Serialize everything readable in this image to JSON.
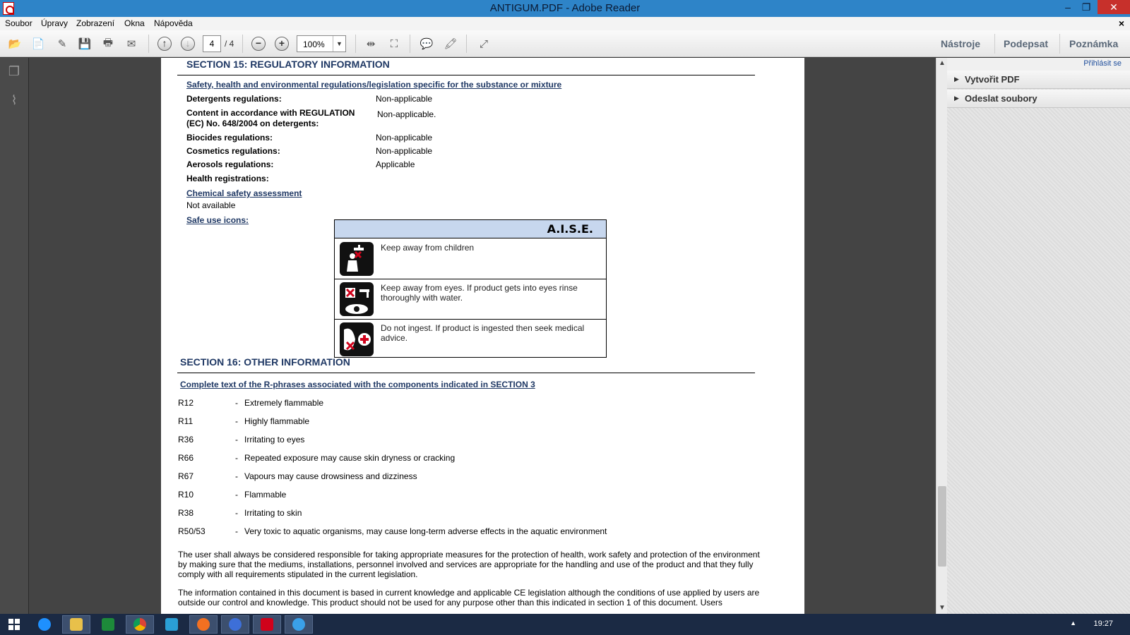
{
  "window": {
    "title": "ANTIGUM.PDF - Adobe Reader"
  },
  "menu": {
    "items": [
      "Soubor",
      "Úpravy",
      "Zobrazení",
      "Okna",
      "Nápověda"
    ],
    "close_doc": "×"
  },
  "toolbar": {
    "page_current": "4",
    "page_total": "/ 4",
    "zoom": "100%",
    "right_tabs": [
      "Nástroje",
      "Podepsat",
      "Poznámka"
    ]
  },
  "right_pane": {
    "signin": "Přihlásit se",
    "items": [
      "Vytvořit PDF",
      "Odeslat soubory"
    ]
  },
  "document": {
    "section15": {
      "title": "SECTION 15: REGULATORY INFORMATION",
      "subheading": "Safety, health and environmental regulations/legislation specific for the substance or mixture",
      "rows": [
        {
          "label": "Detergents regulations:",
          "value": "Non-applicable"
        },
        {
          "label": "Content in accordance with REGULATION (EC) No. 648/2004 on detergents:",
          "value": "Non-applicable."
        },
        {
          "label": "Biocides regulations:",
          "value": "Non-applicable"
        },
        {
          "label": "Cosmetics regulations:",
          "value": "Non-applicable"
        },
        {
          "label": "Aerosols regulations:",
          "value": "Applicable"
        },
        {
          "label": "Health registrations:",
          "value": ""
        }
      ],
      "csa_heading": "Chemical safety assessment",
      "csa_value": "Not available",
      "safe_use_heading": "Safe use icons:",
      "aise_title": "A.I.S.E.",
      "aise_rows": [
        {
          "icon": "keep-away-children-icon",
          "text": "Keep away from children"
        },
        {
          "icon": "keep-away-eyes-icon",
          "text": "Keep away from eyes. If product gets into eyes rinse thoroughly with water."
        },
        {
          "icon": "do-not-ingest-icon",
          "text": "Do not ingest. If product is ingested then seek medical advice."
        }
      ]
    },
    "section16": {
      "title": "SECTION 16: OTHER INFORMATION",
      "subheading": "Complete text of the R-phrases associated with the components indicated in SECTION 3",
      "phrases": [
        {
          "code": "R12",
          "text": "Extremely flammable"
        },
        {
          "code": "R11",
          "text": "Highly flammable"
        },
        {
          "code": "R36",
          "text": "Irritating to eyes"
        },
        {
          "code": "R66",
          "text": "Repeated exposure may cause skin dryness or cracking"
        },
        {
          "code": "R67",
          "text": "Vapours may cause drowsiness and dizziness"
        },
        {
          "code": "R10",
          "text": "Flammable"
        },
        {
          "code": "R38",
          "text": "Irritating to skin"
        },
        {
          "code": "R50/53",
          "text": "Very toxic to aquatic organisms, may cause long-term adverse effects in the aquatic environment"
        }
      ],
      "dash": "-",
      "para1": "The user shall always be considered responsible for taking appropriate measures for the protection of health, work safety and protection of the environment by making sure that the mediums, installations, personnel involved and services are appropriate for the handling and use of the product and that they fully comply with all requirements stipulated in the current legislation.",
      "para2": "The information contained in this document is based in current knowledge and applicable CE legislation although the conditions of use applied by users are outside our control and knowledge. This product should not be used for any purpose other than this indicated in section 1 of this document. Users"
    }
  },
  "taskbar": {
    "clock": "19:27",
    "apps": [
      "start-icon",
      "internet-explorer-icon",
      "file-explorer-icon",
      "excel-icon",
      "chrome-icon",
      "email-app-icon",
      "avast-icon",
      "network-app-icon",
      "adobe-reader-icon",
      "remote-app-icon"
    ]
  }
}
